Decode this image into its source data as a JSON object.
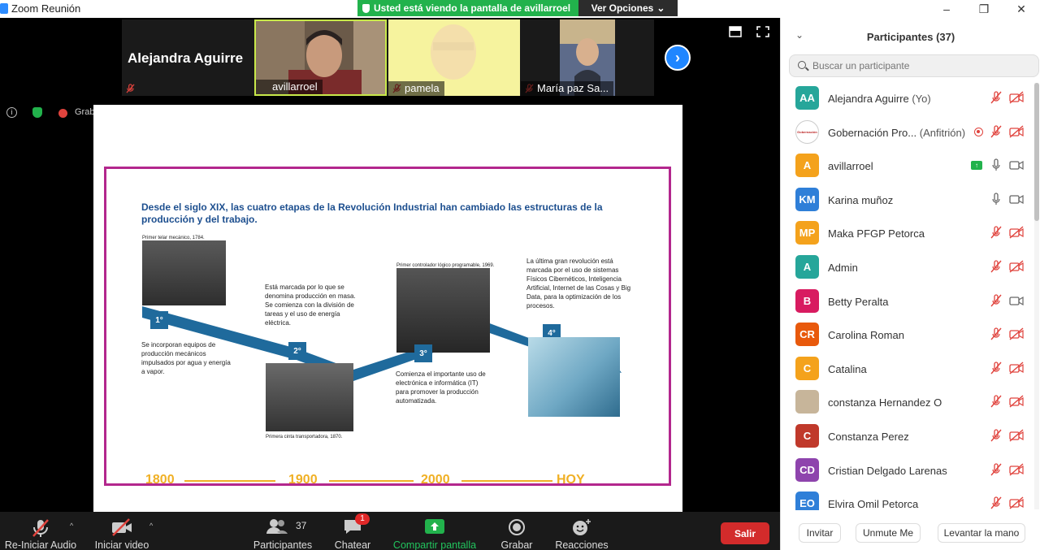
{
  "window": {
    "title": "Zoom Reunión",
    "minimize": "–",
    "maximize": "❐",
    "close": "✕"
  },
  "share_banner": {
    "text": "Usted está viendo la pantalla de avillarroel",
    "view_options": "Ver Opciones"
  },
  "video_strip": {
    "active_speaker_name": "Alejandra Aguirre",
    "tiles": [
      {
        "name": "avillarroel"
      },
      {
        "name": "pamela"
      },
      {
        "name": "María paz Sa..."
      }
    ]
  },
  "status": {
    "recording_label": "Grab"
  },
  "slide": {
    "headline": "Desde el siglo XIX, las cuatro etapas de la Revolución Industrial han cambiado las estructuras de la producción y del trabajo.",
    "stages": [
      {
        "badge": "1°",
        "photo_caption": "Primer telar mecánico, 1784.",
        "text": "Se incorporan equipos de producción mecánicos impulsados por agua y energía a vapor."
      },
      {
        "badge": "2°",
        "photo_caption": "Primera cinta transportadora, 1870.",
        "text": "Está marcada por lo que se denomina producción en masa. Se comienza con la división de tareas y el uso de energía eléctrica."
      },
      {
        "badge": "3°",
        "photo_caption": "Primer controlador lógico programable, 1969.",
        "text": "Comienza el importante uso de electrónica e informática (IT) para promover la producción automatizada."
      },
      {
        "badge": "4°",
        "photo_caption": "",
        "text": "La última gran revolución está marcada por el uso de sistemas Físicos Cibernéticos, Inteligencia Artificial, Internet de las Cosas y Big Data, para la optimización de los procesos."
      }
    ],
    "years": [
      "1800",
      "1900",
      "2000",
      "HOY"
    ]
  },
  "toolbar": {
    "audio": "Re-Iniciar Audio",
    "video": "Iniciar video",
    "participants": "Participantes",
    "participants_count": "37",
    "chat": "Chatear",
    "chat_badge": "1",
    "share": "Compartir pantalla",
    "record": "Grabar",
    "reactions": "Reacciones",
    "leave": "Salir"
  },
  "panel": {
    "title": "Participantes (37)",
    "search_placeholder": "Buscar un participante",
    "participants": [
      {
        "initials": "AA",
        "name": "Alejandra Aguirre",
        "role": " (Yo)",
        "color": "#26a69a",
        "mic": "muted",
        "cam": "off"
      },
      {
        "initials": "Gobernación",
        "name": "Gobernación Pro...",
        "role": " (Anfitrión)",
        "color": "#ffffff",
        "mic": "muted",
        "cam": "off",
        "recording": true,
        "logo": true
      },
      {
        "initials": "A",
        "name": "avillarroel",
        "role": "",
        "color": "#f4a21c",
        "mic": "on",
        "cam": "on",
        "sharing": true
      },
      {
        "initials": "KM",
        "name": "Karina muñoz",
        "role": "",
        "color": "#2f7fd8",
        "mic": "on",
        "cam": "on"
      },
      {
        "initials": "MP",
        "name": " Maka PFGP Petorca",
        "role": "",
        "color": "#f4a21c",
        "mic": "muted",
        "cam": "off"
      },
      {
        "initials": "A",
        "name": "Admin",
        "role": "",
        "color": "#26a69a",
        "mic": "muted",
        "cam": "off"
      },
      {
        "initials": "B",
        "name": "Betty Peralta",
        "role": "",
        "color": "#d81b60",
        "mic": "muted",
        "cam": "on"
      },
      {
        "initials": "CR",
        "name": "Carolina Roman",
        "role": "",
        "color": "#e8590c",
        "mic": "muted",
        "cam": "off"
      },
      {
        "initials": "C",
        "name": "Catalina",
        "role": "",
        "color": "#f4a21c",
        "mic": "muted",
        "cam": "off"
      },
      {
        "initials": "",
        "name": "constanza Hernandez O",
        "role": "",
        "color": "#c7b59a",
        "mic": "muted",
        "cam": "off",
        "photo": true
      },
      {
        "initials": "C",
        "name": "Constanza Perez",
        "role": "",
        "color": "#c0392b",
        "mic": "muted",
        "cam": "off"
      },
      {
        "initials": "CD",
        "name": "Cristian Delgado Larenas",
        "role": "",
        "color": "#8e44ad",
        "mic": "muted",
        "cam": "off"
      },
      {
        "initials": "EO",
        "name": "Elvira Omil Petorca",
        "role": "",
        "color": "#2f7fd8",
        "mic": "muted",
        "cam": "off"
      }
    ],
    "footer": {
      "invite": "Invitar",
      "unmute": "Unmute Me",
      "raise_hand": "Levantar la mano"
    }
  }
}
